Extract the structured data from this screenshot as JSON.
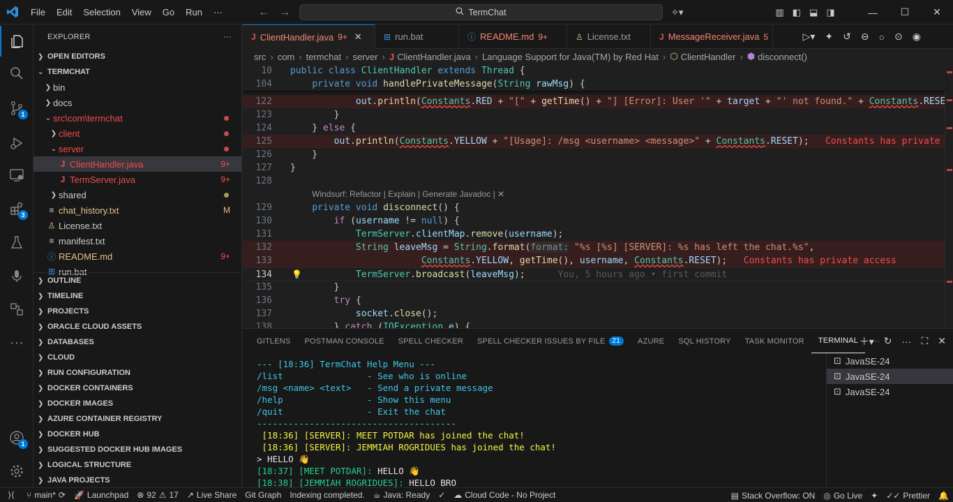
{
  "titlebar": {
    "menu": [
      "File",
      "Edit",
      "Selection",
      "View",
      "Go",
      "Run",
      "···"
    ],
    "search_text": "TermChat"
  },
  "explorer": {
    "title": "EXPLORER",
    "open_editors": "OPEN EDITORS",
    "project": "TERMCHAT",
    "tree": [
      {
        "label": "bin",
        "type": "folder",
        "depth": 1,
        "open": false
      },
      {
        "label": "docs",
        "type": "folder",
        "depth": 1,
        "open": false
      },
      {
        "label": "src\\com\\termchat",
        "type": "folder",
        "depth": 1,
        "open": true,
        "status": "error-dot"
      },
      {
        "label": "client",
        "type": "folder",
        "depth": 2,
        "open": false,
        "status": "error-dot"
      },
      {
        "label": "server",
        "type": "folder",
        "depth": 2,
        "open": true,
        "status": "error-dot"
      },
      {
        "label": "ClientHandler.java",
        "type": "java",
        "depth": 3,
        "tag": "9+",
        "selected": true
      },
      {
        "label": "TermServer.java",
        "type": "java",
        "depth": 3,
        "tag": "9+"
      },
      {
        "label": "shared",
        "type": "folder",
        "depth": 2,
        "open": false,
        "status": "mod-dot"
      },
      {
        "label": "chat_history.txt",
        "type": "txt",
        "depth": 1,
        "tag": "M"
      },
      {
        "label": "License.txt",
        "type": "license",
        "depth": 1
      },
      {
        "label": "manifest.txt",
        "type": "txt",
        "depth": 1
      },
      {
        "label": "README.md",
        "type": "info",
        "depth": 1,
        "tag": "9+"
      },
      {
        "label": "run.bat",
        "type": "bat",
        "depth": 1
      }
    ],
    "sections": [
      "OUTLINE",
      "TIMELINE",
      "PROJECTS",
      "ORACLE CLOUD ASSETS",
      "DATABASES",
      "CLOUD",
      "RUN CONFIGURATION",
      "DOCKER CONTAINERS",
      "DOCKER IMAGES",
      "AZURE CONTAINER REGISTRY",
      "DOCKER HUB",
      "SUGGESTED DOCKER HUB IMAGES",
      "LOGICAL STRUCTURE",
      "JAVA PROJECTS"
    ]
  },
  "activity_badges": {
    "source_control": "1",
    "extensions": "3",
    "accounts": "1"
  },
  "tabs": [
    {
      "label": "ClientHandler.java",
      "tag": "9+",
      "icon": "java",
      "active": true
    },
    {
      "label": "run.bat",
      "tag": "",
      "icon": "windows",
      "active": false
    },
    {
      "label": "README.md",
      "tag": "9+",
      "icon": "info",
      "active": false
    },
    {
      "label": "License.txt",
      "tag": "",
      "icon": "license",
      "active": false
    },
    {
      "label": "MessageReceiver.java",
      "tag": "5",
      "icon": "java",
      "active": false
    }
  ],
  "breadcrumb": [
    "src",
    "com",
    "termchat",
    "server",
    "ClientHandler.java",
    "Language Support for Java(TM) by Red Hat",
    "ClientHandler",
    "disconnect()"
  ],
  "editor": {
    "codelens": "Windsurf: Refactor | Explain | Generate Javadoc | ✕",
    "blame": "You, 5 hours ago • first commit",
    "error_inline": "Constants has private access",
    "error_inline_2": "Constants has private access",
    "line_numbers": [
      "10",
      "104",
      "122",
      "123",
      "124",
      "125",
      "126",
      "127",
      "128",
      "129",
      "130",
      "131",
      "132",
      "133",
      "134",
      "135",
      "136",
      "137",
      "138"
    ]
  },
  "panel": {
    "tabs": [
      "GITLENS",
      "POSTMAN CONSOLE",
      "SPELL CHECKER",
      "SPELL CHECKER ISSUES BY FILE",
      "AZURE",
      "SQL HISTORY",
      "TASK MONITOR",
      "TERMINAL"
    ],
    "spell_badge": "21",
    "terminals": [
      "JavaSE-24",
      "JavaSE-24",
      "JavaSE-24"
    ],
    "terminal_lines": [
      {
        "text": "--- [18:36] TermChat Help Menu ---",
        "color": "cyan"
      },
      {
        "text": "/list                - See who is online",
        "color": "cyan"
      },
      {
        "text": "/msg <name> <text>   - Send a private message",
        "color": "cyan"
      },
      {
        "text": "/help                - Show this menu",
        "color": "cyan"
      },
      {
        "text": "/quit                - Exit the chat",
        "color": "cyan"
      },
      {
        "text": "--------------------------------------",
        "color": "cyan"
      },
      {
        "text": " [18:36] [SERVER]: MEET POTDAR has joined the chat!",
        "color": "yellow"
      },
      {
        "text": " [18:36] [SERVER]: JEMMIAH ROGRIDUES has joined the chat!",
        "color": "yellow"
      },
      {
        "text": "> HELLO 👋",
        "color": "white"
      },
      {
        "text": "[18:37] [MEET POTDAR]: HELLO 👋",
        "color": "mixed",
        "prefix": "[18:37] [MEET POTDAR]:",
        "suffix": " HELLO 👋"
      },
      {
        "text": "[18:38] [JEMMIAH ROGRIDUES]: HELLO BRO",
        "color": "mixed",
        "prefix": "[18:38] [JEMMIAH ROGRIDUES]:",
        "suffix": " HELLO BRO"
      }
    ]
  },
  "statusbar": {
    "branch": "main*",
    "launchpad": "Launchpad",
    "errors": "92",
    "warnings": "17",
    "live_share": "Live Share",
    "git_graph": "Git Graph",
    "indexing": "Indexing completed.",
    "java": "Java: Ready",
    "cloud_code": "Cloud Code - No Project",
    "stack_overflow": "Stack Overflow: ON",
    "go_live": "Go Live",
    "prettier": "Prettier"
  }
}
